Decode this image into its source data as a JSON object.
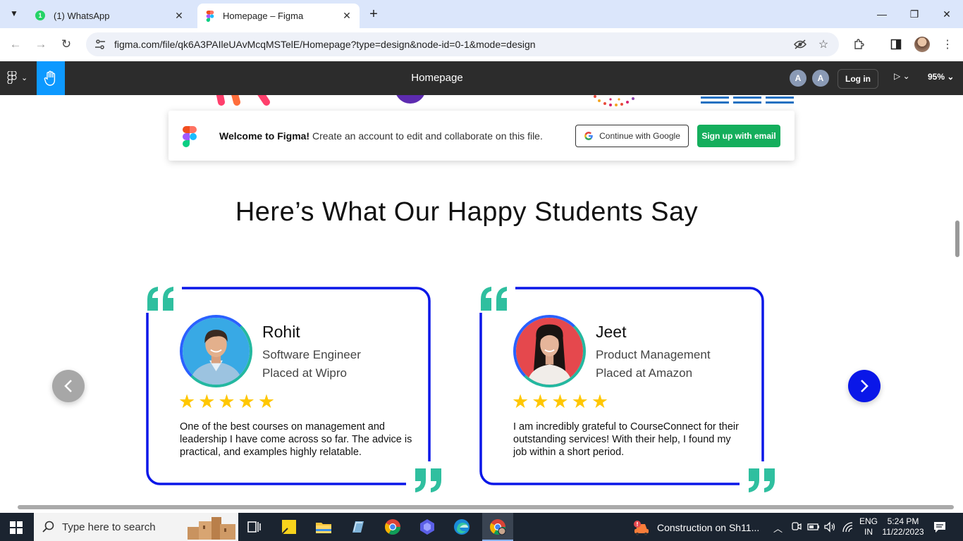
{
  "browser": {
    "tabs": [
      {
        "label": "(1) WhatsApp",
        "favicon": "whatsapp-icon",
        "active": false
      },
      {
        "label": "Homepage – Figma",
        "favicon": "figma-icon",
        "active": true
      }
    ],
    "url": "figma.com/file/qk6A3PAIleUAvMcqMSTelE/Homepage?type=design&node-id=0-1&mode=design"
  },
  "figma": {
    "file_title": "Homepage",
    "avatars": [
      "A",
      "A"
    ],
    "login_label": "Log in",
    "zoom": "95%"
  },
  "welcome_banner": {
    "bold": "Welcome to Figma!",
    "text": " Create an account to edit and collaborate on this file.",
    "google_label": "Continue with Google",
    "email_label": "Sign up with email"
  },
  "page": {
    "heading": "Here’s What Our Happy Students Say",
    "testimonials": [
      {
        "name": "Rohit",
        "role": "Software Engineer",
        "placed": "Placed at Wipro",
        "stars": "★★★★★",
        "rating": 5,
        "quote": "One of the best courses on management and leadership I have come across so far. The advice is practical, and examples highly relatable."
      },
      {
        "name": "Jeet",
        "role": "Product Management",
        "placed": "Placed at Amazon",
        "stars": "★★★★★",
        "rating": 5,
        "quote": "I am incredibly grateful to CourseConnect for their outstanding services! With their help, I found my job within a short period."
      }
    ]
  },
  "taskbar": {
    "search_placeholder": "Type here to search",
    "news": "Construction on Sh11...",
    "lang_top": "ENG",
    "lang_bottom": "IN",
    "time": "5:24 PM",
    "date": "11/22/2023"
  },
  "colors": {
    "accent_blue": "#0a17e8",
    "quote_teal": "#2fbf9f",
    "star_yellow": "#ffc700",
    "figma_green": "#14ae5c"
  }
}
